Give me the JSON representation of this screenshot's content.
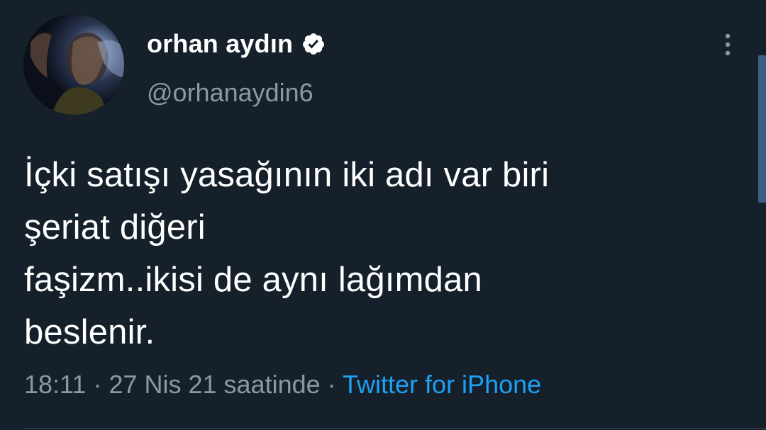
{
  "tweet": {
    "author": {
      "display_name": "orhan aydın",
      "handle": "@orhanaydin6",
      "verified": true,
      "avatar_icon": "profile-photo"
    },
    "text": "İçki satışı yasağının iki adı var biri\nşeriat diğeri\nfaşizm..ikisi de aynı lağımdan\nbeslenir.",
    "time": "18:11",
    "separator": "·",
    "date": "27 Nis 21 saatinde",
    "source": "Twitter for iPhone",
    "more_icon": "more-vertical-icon"
  },
  "colors": {
    "background": "#15202b",
    "text": "#ffffff",
    "secondary_text": "#8899a6",
    "link": "#1da1f2",
    "divider": "#38444d"
  }
}
